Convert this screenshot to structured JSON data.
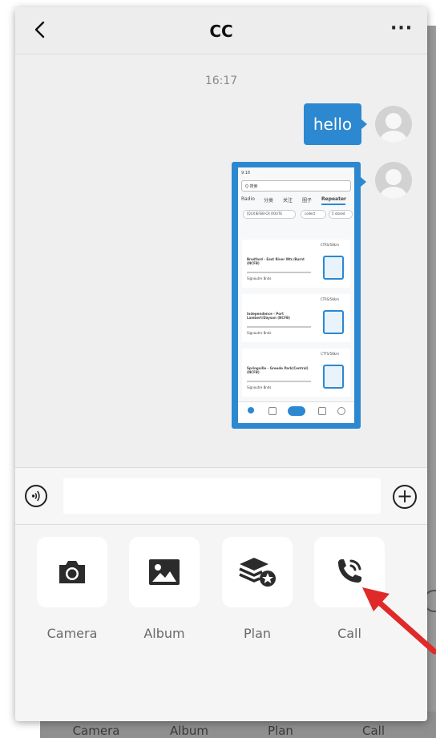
{
  "header": {
    "title": "CC",
    "more": "···"
  },
  "chat": {
    "timestamp": "16:17",
    "messages": [
      {
        "text": "hello",
        "sender": "me"
      }
    ]
  },
  "screenshot_message": {
    "status_time": "9:16",
    "search_placeholder": "Q 搜索",
    "tabs": [
      "Radio",
      "分类",
      "关注",
      "圈子",
      "Repeater"
    ],
    "chips": [
      "[QCX]EFEB-CR ROUTE",
      "collect",
      "5 stored"
    ],
    "cards": [
      {
        "meta": "CTRS/58km",
        "name": "Bradford - East River Wtr./Burnt (NCFB)",
        "sub": "Signoutre Bnds"
      },
      {
        "meta": "CTRS/58km",
        "name": "Independence - Port Lambert/Dayson (NCFB)",
        "sub": "Signoutre Bnds"
      },
      {
        "meta": "CTTS/58km",
        "name": "Springville - Greede Park(Central) (NCFB)",
        "sub": "Signoutre Bnds"
      }
    ]
  },
  "input_bar": {
    "placeholder": "",
    "value": ""
  },
  "actions": [
    {
      "label": "Camera",
      "icon": "camera-icon"
    },
    {
      "label": "Album",
      "icon": "image-icon"
    },
    {
      "label": "Plan",
      "icon": "layers-star-icon"
    },
    {
      "label": "Call",
      "icon": "phone-call-icon"
    }
  ],
  "background_actions": [
    "Camera",
    "Album",
    "Plan",
    "Call"
  ],
  "colors": {
    "accent": "#2c88d0",
    "arrow": "#e02a2a",
    "panel": "#f5f5f5",
    "chat_bg": "#efefef"
  }
}
